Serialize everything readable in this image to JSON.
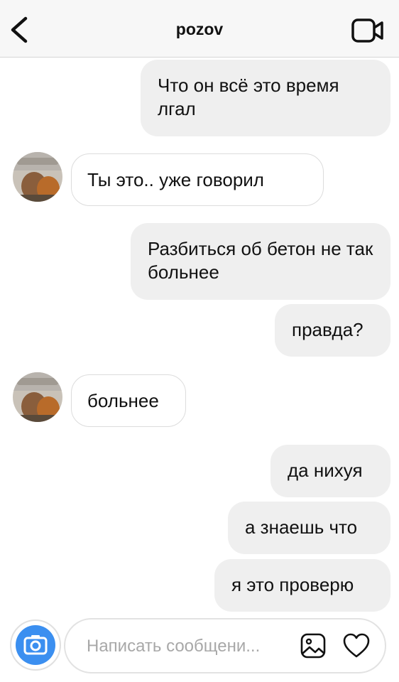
{
  "header": {
    "title": "pozov",
    "back_icon": "chevron-left-icon",
    "video_icon": "video-camera-icon"
  },
  "messages": [
    {
      "from": "me",
      "text": "Что он всё это время лгал"
    },
    {
      "from": "them",
      "text": "Ты это.. уже говорил"
    },
    {
      "from": "me",
      "text": "Разбиться об бетон не так больнее"
    },
    {
      "from": "me",
      "text": "правда?"
    },
    {
      "from": "them",
      "text": "больнее"
    },
    {
      "from": "me",
      "text": "да нихуя"
    },
    {
      "from": "me",
      "text": "а знаешь что"
    },
    {
      "from": "me",
      "text": "я это проверю"
    }
  ],
  "composer": {
    "placeholder": "Написать сообщени...",
    "camera_icon": "camera-icon",
    "gallery_icon": "gallery-icon",
    "heart_icon": "heart-icon"
  },
  "colors": {
    "outgoing_bubble": "#efefef",
    "camera_button": "#3b8ff0"
  }
}
